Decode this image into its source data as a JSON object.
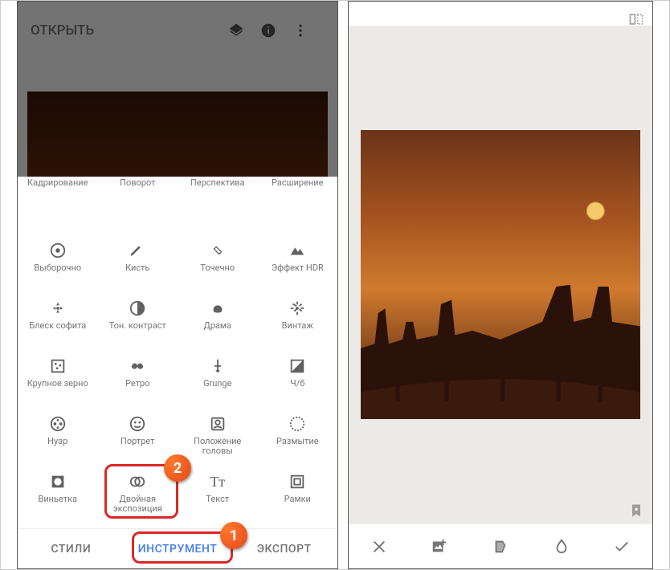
{
  "left": {
    "header": {
      "open_label": "ОТКРЫТЬ",
      "icons": {
        "layers": "layers-icon",
        "info": "info-icon",
        "more": "more-icon"
      }
    },
    "tools": [
      {
        "name": "crop-icon",
        "label": "Кадрирование"
      },
      {
        "name": "rotate-icon",
        "label": "Поворот"
      },
      {
        "name": "perspective-icon",
        "label": "Перспектива"
      },
      {
        "name": "expand-icon",
        "label": "Расширение"
      },
      {
        "name": "selective-icon",
        "label": "Выборочно"
      },
      {
        "name": "brush-icon",
        "label": "Кисть"
      },
      {
        "name": "healing-icon",
        "label": "Точечно"
      },
      {
        "name": "hdr-icon",
        "label": "Эффект HDR"
      },
      {
        "name": "glamour-icon",
        "label": "Блеск софита"
      },
      {
        "name": "tonal-icon",
        "label": "Тон. контраст"
      },
      {
        "name": "drama-icon",
        "label": "Драма"
      },
      {
        "name": "vintage-icon",
        "label": "Винтаж"
      },
      {
        "name": "grainy-icon",
        "label": "Крупное зерно"
      },
      {
        "name": "retro-icon",
        "label": "Ретро"
      },
      {
        "name": "grunge-icon",
        "label": "Grunge"
      },
      {
        "name": "bw-icon",
        "label": "Ч/б"
      },
      {
        "name": "noir-icon",
        "label": "Нуар"
      },
      {
        "name": "portrait-icon",
        "label": "Портрет"
      },
      {
        "name": "headpose-icon",
        "label": "Положение головы"
      },
      {
        "name": "blur-icon",
        "label": "Размытие"
      },
      {
        "name": "vignette-icon",
        "label": "Виньетка"
      },
      {
        "name": "double-exposure-icon",
        "label": "Двойная экспозиция"
      },
      {
        "name": "text-icon",
        "label": "Текст"
      },
      {
        "name": "frames-icon",
        "label": "Рамки"
      }
    ],
    "tabs": {
      "styles": "СТИЛИ",
      "tools": "ИНСТРУМЕНТ",
      "export": "ЭКСПОРТ"
    },
    "badges": {
      "one": "1",
      "two": "2"
    }
  },
  "right": {
    "header_icon": "compare-icon",
    "bookmark": "bookmark-icon",
    "toolbar": {
      "close": "close-icon",
      "add_image": "add-image-icon",
      "style": "style-icon",
      "opacity": "opacity-icon",
      "confirm": "check-icon"
    }
  }
}
